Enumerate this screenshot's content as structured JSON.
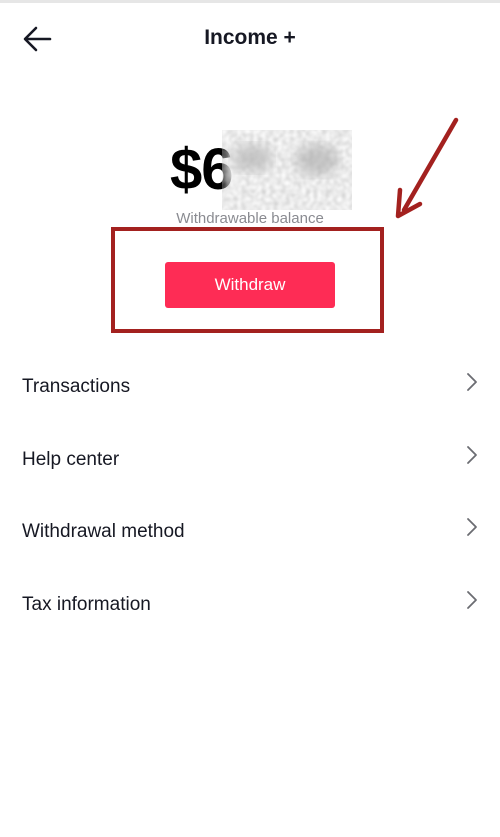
{
  "header": {
    "title": "Income +",
    "back_icon": "back-arrow-icon"
  },
  "balance": {
    "amount_visible": "$6",
    "label": "Withdrawable balance"
  },
  "withdraw": {
    "label": "Withdraw"
  },
  "menu": {
    "items": [
      {
        "label": "Transactions"
      },
      {
        "label": "Help center"
      },
      {
        "label": "Withdrawal method"
      },
      {
        "label": "Tax information"
      }
    ]
  },
  "colors": {
    "accent": "#fe2c55",
    "annotation": "#a3211f",
    "text_primary": "#161823",
    "text_secondary": "#8a8b91"
  }
}
